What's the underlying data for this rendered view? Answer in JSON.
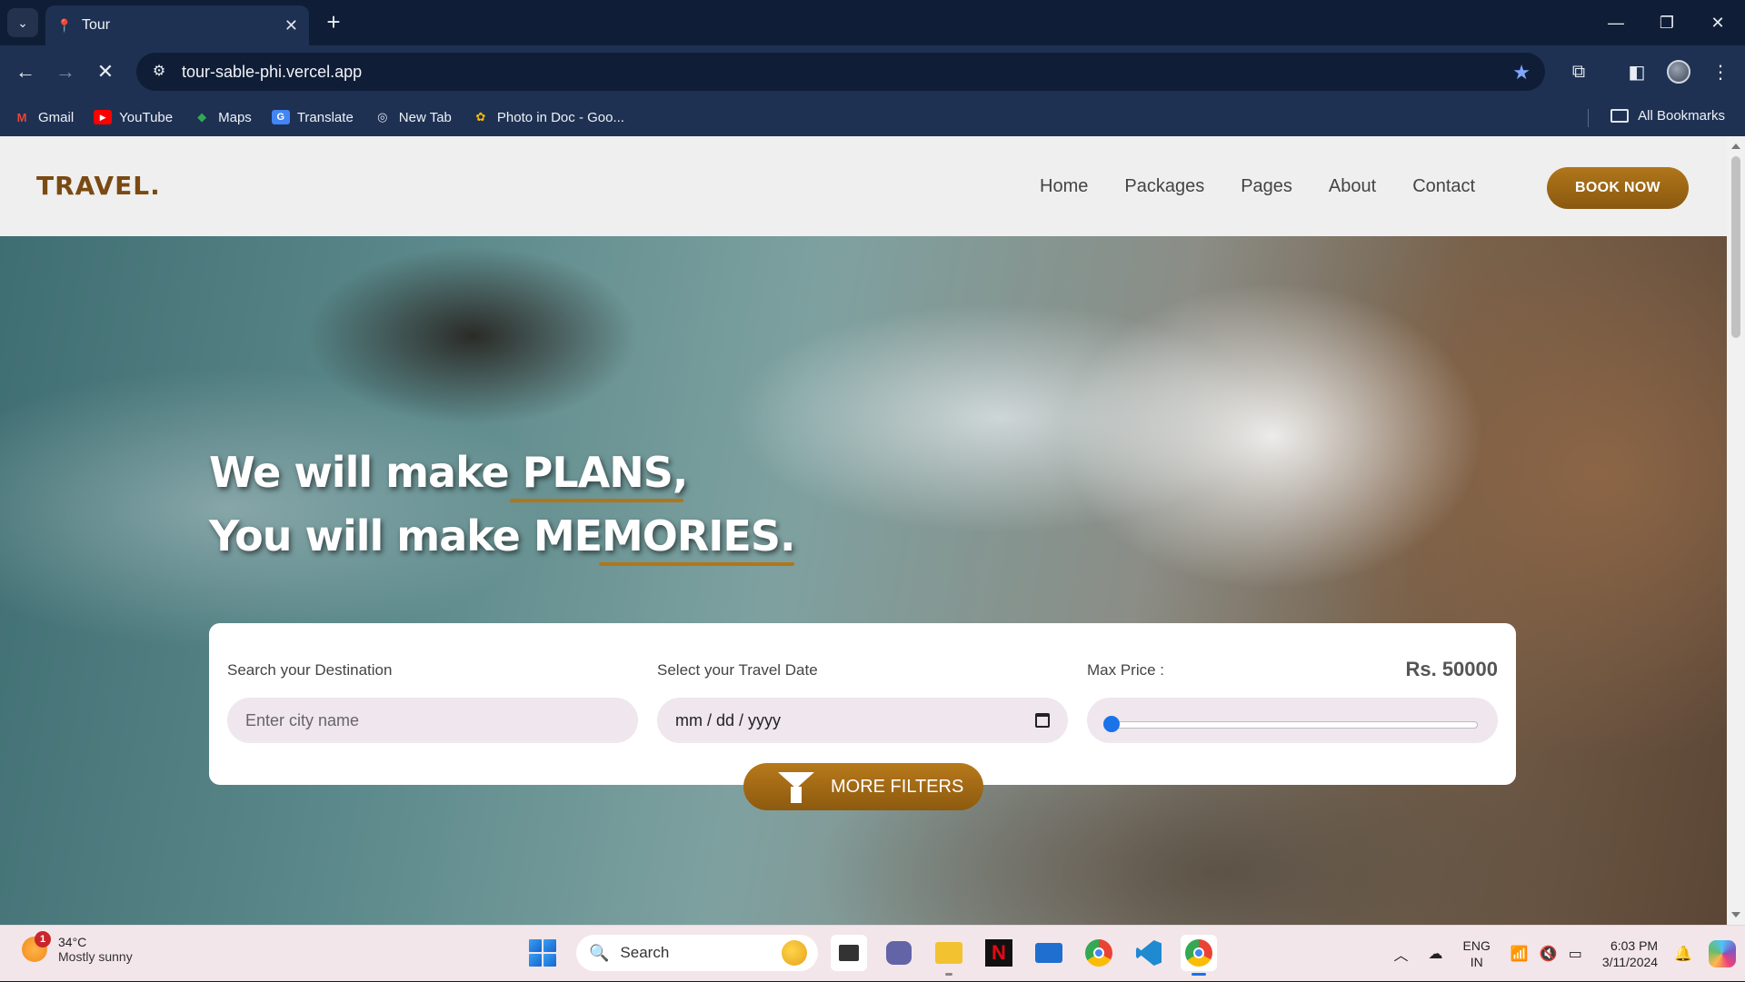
{
  "browser": {
    "tab_title": "Tour",
    "url": "tour-sable-phi.vercel.app",
    "bookmarks": [
      {
        "label": "Gmail",
        "icon": "gmail-icon"
      },
      {
        "label": "YouTube",
        "icon": "youtube-icon"
      },
      {
        "label": "Maps",
        "icon": "maps-icon"
      },
      {
        "label": "Translate",
        "icon": "translate-icon"
      },
      {
        "label": "New Tab",
        "icon": "globe-icon"
      },
      {
        "label": "Photo in Doc - Goo...",
        "icon": "photos-icon"
      }
    ],
    "all_bookmarks_label": "All Bookmarks"
  },
  "site": {
    "logo": "TRAVEL.",
    "nav": [
      "Home",
      "Packages",
      "Pages",
      "About",
      "Contact"
    ],
    "book_now": "BOOK NOW",
    "headline_line1_pre": "We will make ",
    "headline_line1_hl": "PLANS,",
    "headline_line2_pre": "You will make ",
    "headline_line2_hl": "MEMORIES.",
    "search": {
      "destination_label": "Search your Destination",
      "destination_placeholder": "Enter city name",
      "date_label": "Select your Travel Date",
      "date_placeholder": "mm / dd / yyyy",
      "price_label": "Max Price :",
      "price_value": "Rs. 50000",
      "price_slider_fraction": 0.0
    },
    "more_filters": "MORE FILTERS",
    "colors": {
      "accent": "#a06815",
      "logo": "#7a4a12"
    }
  },
  "taskbar": {
    "weather_temp": "34°C",
    "weather_desc": "Mostly sunny",
    "weather_badge": "1",
    "search_label": "Search",
    "lang_top": "ENG",
    "lang_bottom": "IN",
    "time": "6:03 PM",
    "date": "3/11/2024"
  }
}
